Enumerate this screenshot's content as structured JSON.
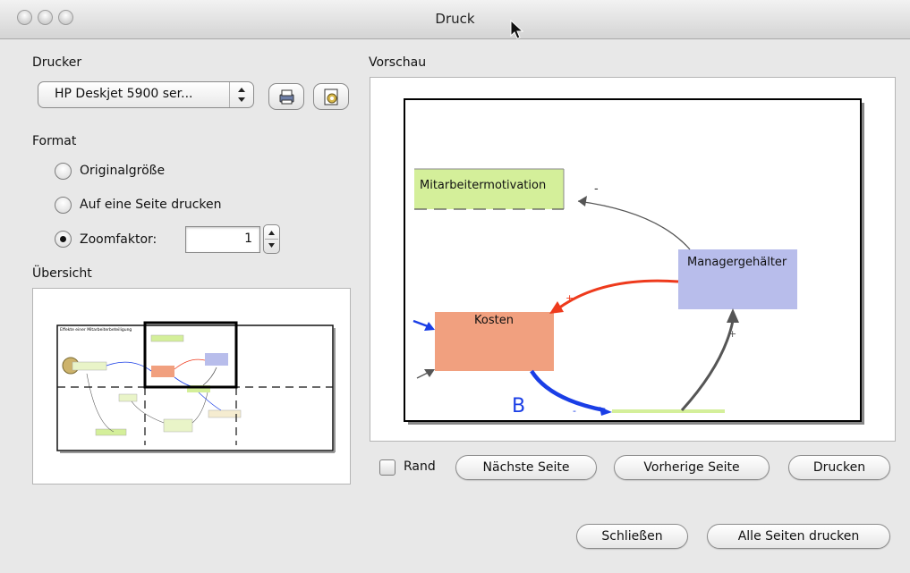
{
  "window": {
    "title": "Druck"
  },
  "printer": {
    "label": "Drucker",
    "selected": "HP Deskjet 5900 ser..."
  },
  "format": {
    "label": "Format",
    "options": [
      "Originalgröße",
      "Auf eine Seite drucken",
      "Zoomfaktor:"
    ],
    "zoom_value": "1"
  },
  "overview": {
    "label": "Übersicht",
    "thumb_title": "Effekte einer Mitarbeiterbeteiligung"
  },
  "preview": {
    "label": "Vorschau",
    "nodes": {
      "motivation": "Mitarbeitermotivation",
      "salaries": "Managergehälter",
      "costs": "Kosten"
    },
    "signs": {
      "minus": "-",
      "plus": "+",
      "loop": "B"
    }
  },
  "controls": {
    "margin_label": "Rand",
    "next_page": "Nächste Seite",
    "previous_page": "Vorherige Seite",
    "print": "Drucken",
    "close": "Schließen",
    "print_all": "Alle Seiten drucken"
  },
  "colors": {
    "motivation": "#d4ef9a",
    "salaries": "#b8bdeb",
    "costs": "#f1a07f",
    "red_arrow": "#ee3a1c",
    "blue_arrow": "#1a3ee6"
  }
}
